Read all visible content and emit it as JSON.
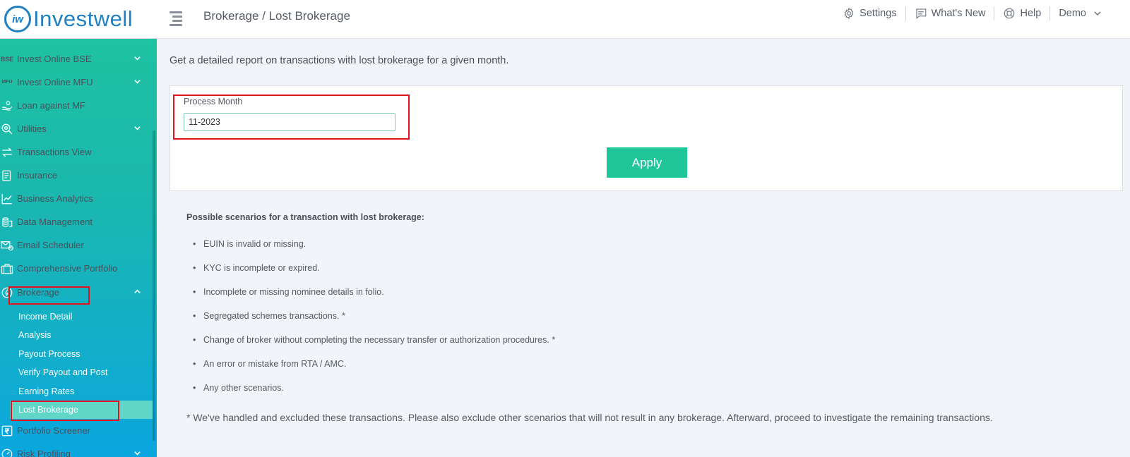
{
  "header": {
    "logo_mark": "iw",
    "logo_text": "Investwell",
    "breadcrumb": "Brokerage / Lost Brokerage",
    "actions": {
      "settings": "Settings",
      "whats_new": "What's New",
      "help": "Help",
      "user": "Demo"
    }
  },
  "sidebar": {
    "items": [
      {
        "label": "Invest Online BSE",
        "icon_text": "BSE"
      },
      {
        "label": "Invest Online MFU",
        "icon_text": "MFU"
      },
      {
        "label": "Loan against MF"
      },
      {
        "label": "Utilities"
      },
      {
        "label": "Transactions View"
      },
      {
        "label": "Insurance"
      },
      {
        "label": "Business Analytics"
      },
      {
        "label": "Data Management"
      },
      {
        "label": "Email Scheduler"
      },
      {
        "label": "Comprehensive Portfolio"
      },
      {
        "label": "Brokerage"
      },
      {
        "label": "Portfolio Screener"
      },
      {
        "label": "Risk Profiling"
      }
    ],
    "brokerage_sub": [
      "Income Detail",
      "Analysis",
      "Payout Process",
      "Verify Payout and Post",
      "Earning Rates",
      "Lost Brokerage"
    ]
  },
  "main": {
    "description": "Get a detailed report on transactions with lost brokerage for a given month.",
    "field_label": "Process Month",
    "field_value": "11-2023",
    "apply_label": "Apply",
    "scenarios_title": "Possible scenarios for a transaction with lost brokerage:",
    "scenarios": [
      "EUIN is invalid or missing.",
      "KYC is incomplete or expired.",
      "Incomplete or missing nominee details in folio.",
      "Segregated schemes transactions. *",
      "Change of broker without completing the necessary transfer or authorization procedures. *",
      "An error or mistake from RTA / AMC.",
      "Any other scenarios."
    ],
    "footnote": "*  We've handled and excluded these transactions. Please also exclude other scenarios that will not result in any brokerage. Afterward, proceed to investigate the remaining transactions."
  },
  "colors": {
    "brand_blue": "#1e7fc2",
    "sidebar_teal": "#1fc2a2",
    "sidebar_blue": "#0aa6df",
    "apply_green": "#21c59a",
    "highlight_red": "#e0141e"
  }
}
